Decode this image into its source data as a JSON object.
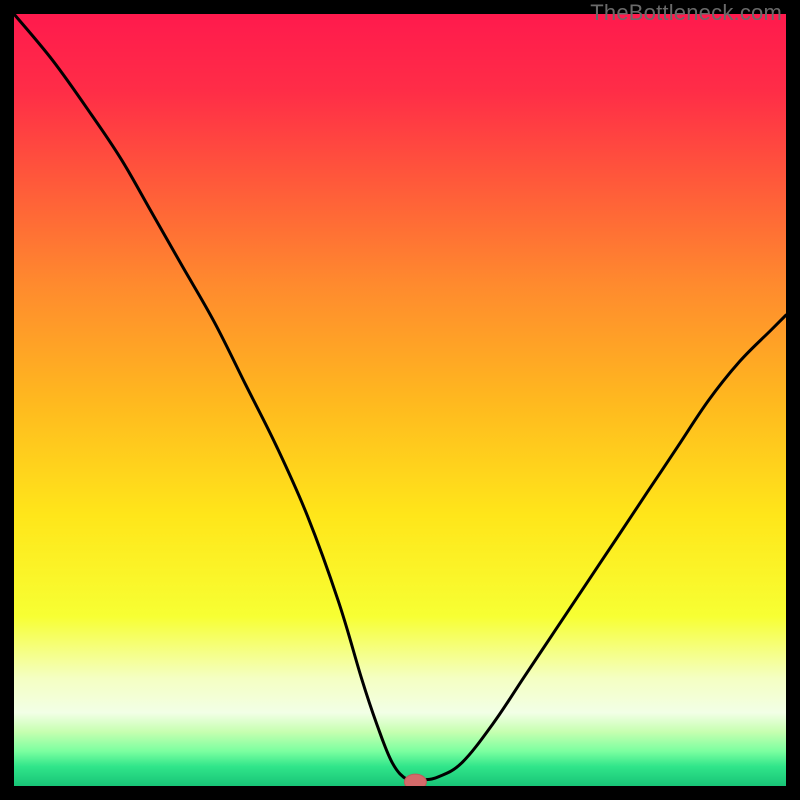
{
  "watermark": "TheBottleneck.com",
  "colors": {
    "bg": "#000000",
    "curve": "#000000",
    "marker_fill": "#d46a6a",
    "marker_stroke": "#c05a5a",
    "gradient_stops": [
      {
        "offset": 0.0,
        "color": "#ff1a4d"
      },
      {
        "offset": 0.1,
        "color": "#ff2d47"
      },
      {
        "offset": 0.22,
        "color": "#ff5a3a"
      },
      {
        "offset": 0.35,
        "color": "#ff8a2e"
      },
      {
        "offset": 0.5,
        "color": "#ffb81f"
      },
      {
        "offset": 0.65,
        "color": "#ffe61a"
      },
      {
        "offset": 0.78,
        "color": "#f7ff33"
      },
      {
        "offset": 0.86,
        "color": "#f4ffc2"
      },
      {
        "offset": 0.905,
        "color": "#f2ffe6"
      },
      {
        "offset": 0.93,
        "color": "#c6ffb0"
      },
      {
        "offset": 0.955,
        "color": "#7bffa0"
      },
      {
        "offset": 0.975,
        "color": "#30e58a"
      },
      {
        "offset": 1.0,
        "color": "#18c477"
      }
    ]
  },
  "chart_data": {
    "type": "line",
    "title": "",
    "xlabel": "",
    "ylabel": "",
    "xlim": [
      0,
      100
    ],
    "ylim": [
      0,
      100
    ],
    "grid": false,
    "legend": false,
    "marker": {
      "x": 52,
      "y": 0.5
    },
    "series": [
      {
        "name": "bottleneck-curve",
        "x": [
          0,
          5,
          10,
          14,
          18,
          22,
          26,
          30,
          34,
          38,
          42,
          45,
          47,
          49,
          51,
          53,
          55,
          58,
          62,
          66,
          70,
          74,
          78,
          82,
          86,
          90,
          94,
          98,
          100
        ],
        "y": [
          100,
          94,
          87,
          81,
          74,
          67,
          60,
          52,
          44,
          35,
          24,
          14,
          8,
          3,
          0.8,
          0.8,
          1.2,
          3,
          8,
          14,
          20,
          26,
          32,
          38,
          44,
          50,
          55,
          59,
          61
        ]
      }
    ]
  }
}
